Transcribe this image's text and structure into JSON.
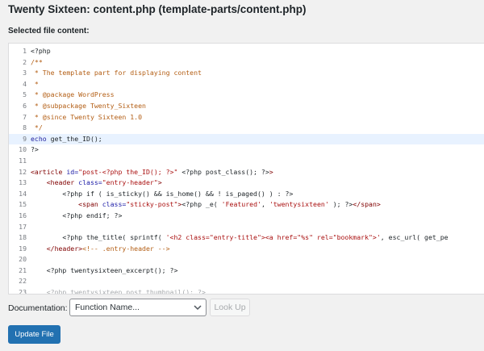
{
  "page": {
    "title": "Twenty Sixteen: content.php (template-parts/content.php)",
    "selected_label": "Selected file content:"
  },
  "editor": {
    "active_line": 9,
    "lines": [
      {
        "n": "1",
        "segs": [
          {
            "t": "<?php",
            "c": "php"
          }
        ]
      },
      {
        "n": "2",
        "segs": [
          {
            "t": "/**",
            "c": "comment"
          }
        ]
      },
      {
        "n": "3",
        "segs": [
          {
            "t": " * The template part for displaying content",
            "c": "comment"
          }
        ]
      },
      {
        "n": "4",
        "segs": [
          {
            "t": " *",
            "c": "comment"
          }
        ]
      },
      {
        "n": "5",
        "segs": [
          {
            "t": " * @package WordPress",
            "c": "comment"
          }
        ]
      },
      {
        "n": "6",
        "segs": [
          {
            "t": " * @subpackage Twenty_Sixteen",
            "c": "comment"
          }
        ]
      },
      {
        "n": "7",
        "segs": [
          {
            "t": " * @since Twenty Sixteen 1.0",
            "c": "comment"
          }
        ]
      },
      {
        "n": "8",
        "segs": [
          {
            "t": " */",
            "c": "comment"
          }
        ]
      },
      {
        "n": "9",
        "segs": [
          {
            "t": "echo",
            "c": "keyword"
          },
          {
            "t": " get_the_ID();",
            "c": "php"
          }
        ]
      },
      {
        "n": "10",
        "segs": [
          {
            "t": "?>",
            "c": "php"
          }
        ]
      },
      {
        "n": "11",
        "segs": []
      },
      {
        "n": "12",
        "segs": [
          {
            "t": "<article",
            "c": "tag"
          },
          {
            "t": " id=",
            "c": "attr"
          },
          {
            "t": "\"post-<?php the_ID(); ?>\"",
            "c": "string"
          },
          {
            "t": " <?php post_class(); ?>",
            "c": "php"
          },
          {
            "t": ">",
            "c": "tag"
          }
        ]
      },
      {
        "n": "13",
        "segs": [
          {
            "t": "    <header",
            "c": "tag"
          },
          {
            "t": " class=",
            "c": "attr"
          },
          {
            "t": "\"entry-header\"",
            "c": "string"
          },
          {
            "t": ">",
            "c": "tag"
          }
        ]
      },
      {
        "n": "14",
        "segs": [
          {
            "t": "        <?php if ( is_sticky() && is_home() && ! is_paged() ) : ?>",
            "c": "php"
          }
        ]
      },
      {
        "n": "15",
        "segs": [
          {
            "t": "            <span",
            "c": "tag"
          },
          {
            "t": " class=",
            "c": "attr"
          },
          {
            "t": "\"sticky-post\"",
            "c": "string"
          },
          {
            "t": ">",
            "c": "tag"
          },
          {
            "t": "<?php _e( ",
            "c": "php"
          },
          {
            "t": "'Featured'",
            "c": "string"
          },
          {
            "t": ", ",
            "c": "php"
          },
          {
            "t": "'twentysixteen'",
            "c": "string"
          },
          {
            "t": " ); ?>",
            "c": "php"
          },
          {
            "t": "</span>",
            "c": "tag"
          }
        ]
      },
      {
        "n": "16",
        "segs": [
          {
            "t": "        <?php endif; ?>",
            "c": "php"
          }
        ]
      },
      {
        "n": "17",
        "segs": []
      },
      {
        "n": "18",
        "segs": [
          {
            "t": "        <?php the_title( sprintf( ",
            "c": "php"
          },
          {
            "t": "'<h2 class=\"entry-title\"><a href=\"%s\" rel=\"bookmark\">'",
            "c": "string"
          },
          {
            "t": ", esc_url( get_pe",
            "c": "php"
          }
        ]
      },
      {
        "n": "19",
        "segs": [
          {
            "t": "    </header>",
            "c": "tag"
          },
          {
            "t": "<!-- .entry-header -->",
            "c": "comment"
          }
        ]
      },
      {
        "n": "20",
        "segs": []
      },
      {
        "n": "21",
        "segs": [
          {
            "t": "    <?php twentysixteen_excerpt(); ?>",
            "c": "php"
          }
        ]
      },
      {
        "n": "22",
        "segs": []
      },
      {
        "n": "23",
        "segs": [
          {
            "t": "    <?php twentysixteen_post_thumbnail(); ?>",
            "c": "fade"
          }
        ]
      }
    ]
  },
  "documentation": {
    "label": "Documentation:",
    "select_value": "Function Name...",
    "lookup_label": "Look Up"
  },
  "update_button_label": "Update File",
  "colors": {
    "accent": "#2271b1",
    "active_line": "#e8f2ff"
  }
}
